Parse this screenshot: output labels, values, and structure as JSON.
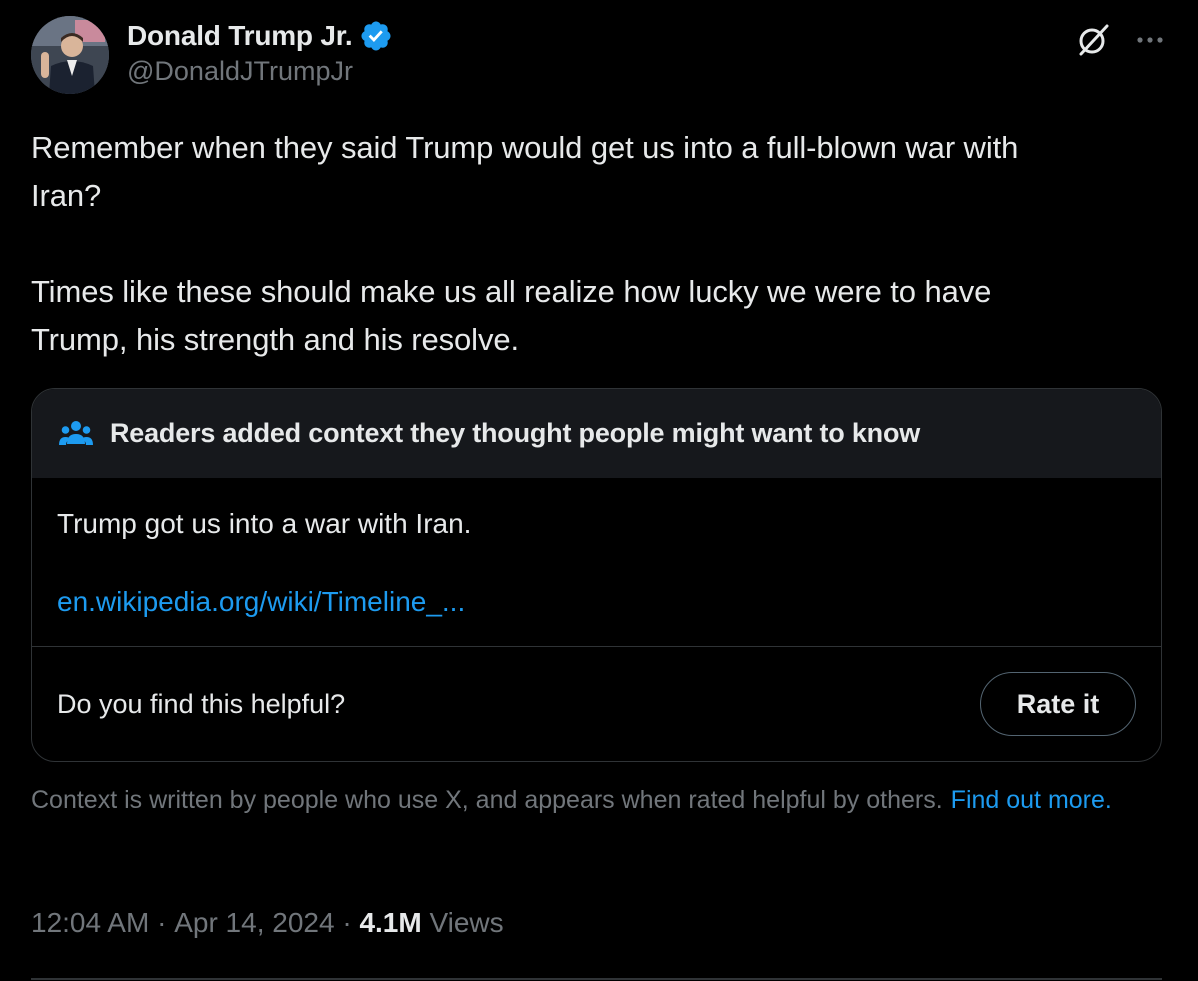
{
  "author": {
    "display_name": "Donald Trump Jr.",
    "handle": "@DonaldJTrumpJr",
    "verified_icon": "verified-badge-icon",
    "avatar": "avatar-photo"
  },
  "header_actions": {
    "grok_icon": "grok-icon",
    "more_icon": "more-options-icon"
  },
  "tweet": {
    "text": "Remember when they said Trump would get us into a full-blown war with\nIran?\n\nTimes like these should make us all realize how lucky we were to have\nTrump, his strength and his resolve."
  },
  "community_note": {
    "header_icon": "people-icon",
    "header_text": "Readers added context they thought people might want to know",
    "body_text": "Trump got us into a war with Iran.",
    "link_text": "en.wikipedia.org/wiki/Timeline_...",
    "helpful_question": "Do you find this helpful?",
    "rate_button_label": "Rate it"
  },
  "context_info": {
    "text": "Context is written by people who use X, and appears when rated helpful by others.",
    "link_text": "Find out more."
  },
  "meta": {
    "time": "12:04 AM",
    "separator": " · ",
    "date": "Apr 14, 2024",
    "views_count": "4.1M",
    "views_label": " Views"
  },
  "colors": {
    "background": "#000000",
    "text_primary": "#e7e9ea",
    "text_secondary": "#71767b",
    "link": "#1d9bf0",
    "note_header_bg": "#16181c",
    "border": "#2f3336",
    "verified": "#1d9bf0"
  }
}
